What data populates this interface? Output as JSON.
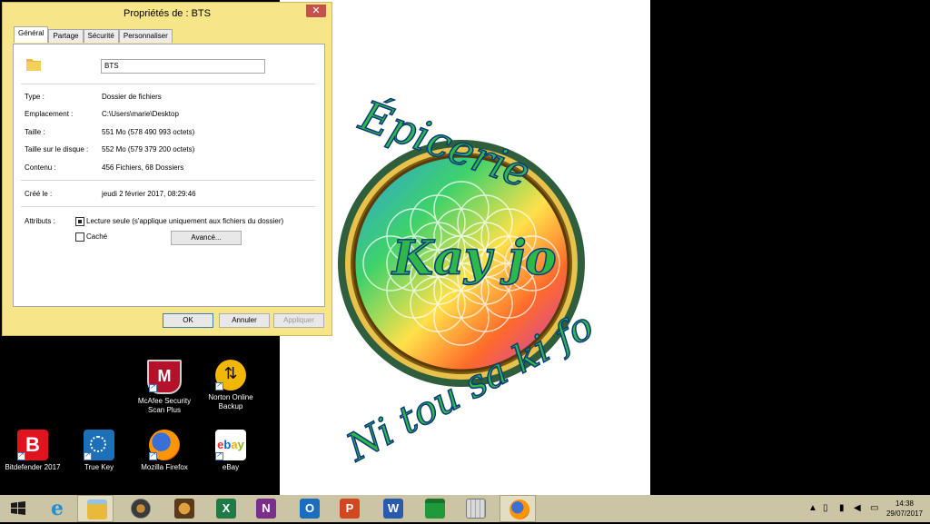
{
  "dialog": {
    "title": "Propriétés de : BTS",
    "close_label": "✕",
    "tabs": [
      "Général",
      "Partage",
      "Sécurité",
      "Personnaliser"
    ],
    "name_value": "BTS",
    "fields": [
      {
        "label": "Type :",
        "value": "Dossier de fichiers"
      },
      {
        "label": "Emplacement :",
        "value": "C:\\Users\\marie\\Desktop"
      },
      {
        "label": "Taille :",
        "value": "551 Mo (578 490 993 octets)"
      },
      {
        "label": "Taille sur le disque :",
        "value": "552 Mo (579 379 200 octets)"
      },
      {
        "label": "Contenu :",
        "value": "456 Fichiers, 68 Dossiers"
      }
    ],
    "created_label": "Créé le :",
    "created_value": "jeudi 2 février 2017, 08:29:46",
    "attributes_label": "Attributs :",
    "readonly_label": "Lecture seule (s'applique uniquement aux fichiers du dossier)",
    "readonly_checked": true,
    "hidden_label": "Caché",
    "hidden_checked": false,
    "advanced_label": "Avancé...",
    "ok_label": "OK",
    "cancel_label": "Annuler",
    "apply_label": "Appliquer"
  },
  "wallpaper": {
    "top_text": "Épicerie",
    "center_text": "Kay jo",
    "bottom_text": "Ni tou sa ki fo"
  },
  "desktop_icons": [
    {
      "name": "mcafee-icon",
      "label_lines": [
        "McAfee Security",
        "Scan Plus"
      ],
      "color": "#b3122a"
    },
    {
      "name": "norton-icon",
      "label_lines": [
        "Norton Online",
        "Backup"
      ],
      "color": "#f2b705"
    },
    {
      "name": "bitdefender-icon",
      "label_lines": [
        "Bitdefender 2017"
      ],
      "color": "#e0131f"
    },
    {
      "name": "truekey-icon",
      "label_lines": [
        "True Key"
      ],
      "color": "#1d6fb8"
    },
    {
      "name": "firefox-icon",
      "label_lines": [
        "Mozilla Firefox"
      ],
      "color": "#e66000"
    },
    {
      "name": "ebay-icon",
      "label_lines": [
        "eBay"
      ],
      "color": "#ffffff"
    }
  ],
  "taskbar": {
    "clock_time": "14:38",
    "clock_date": "29/07/2017",
    "apps": [
      "start-icon",
      "internet-explorer-icon",
      "file-explorer-icon",
      "speaker-app-icon",
      "media-app-icon",
      "excel-icon",
      "onenote-icon",
      "outlook-icon",
      "powerpoint-icon",
      "word-icon",
      "store-icon",
      "calculator-icon",
      "firefox-taskbar-icon"
    ]
  }
}
